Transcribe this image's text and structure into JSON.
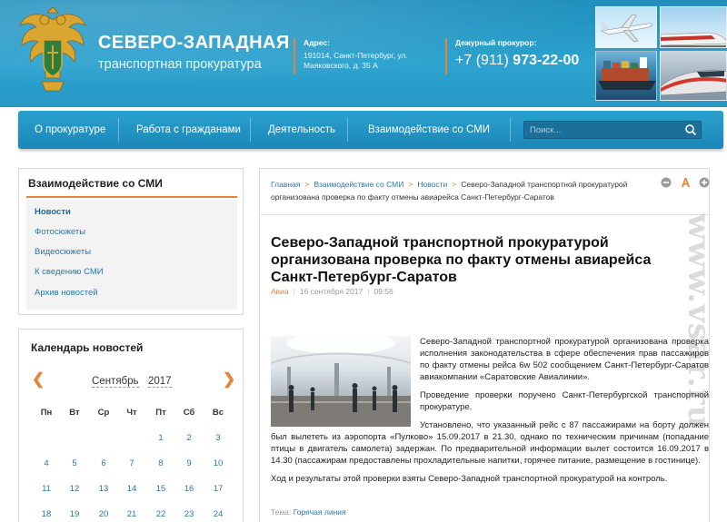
{
  "header": {
    "title": "СЕВЕРО-ЗАПАДНАЯ",
    "subtitle": "транспортная прокуратура",
    "address_label": "Адрес:",
    "address_line1": "191014, Санкт-Петербург, ул.",
    "address_line2": "Маяковского, д. 35 А",
    "duty_label": "Дежурный прокурор:",
    "phone_prefix": "+7 (911) ",
    "phone_main": "973-22-00"
  },
  "nav": {
    "items": [
      "О прокуратуре",
      "Работа с гражданами",
      "Деятельность",
      "Взаимодействие со СМИ"
    ],
    "search_placeholder": "Поиск..."
  },
  "sidebar": {
    "title": "Взаимодействие со СМИ",
    "items": [
      {
        "label": "Новости",
        "active": true
      },
      {
        "label": "Фотосюжеты"
      },
      {
        "label": "Видеосюжеты"
      },
      {
        "label": "К сведению СМИ"
      },
      {
        "label": "Архив новостей"
      }
    ]
  },
  "calendar": {
    "title": "Календарь новостей",
    "prev": "❮",
    "next": "❯",
    "month": "Сентябрь",
    "year": "2017",
    "weekdays": [
      "Пн",
      "Вт",
      "Ср",
      "Чт",
      "Пт",
      "Сб",
      "Вс"
    ],
    "weeks": [
      [
        "",
        "",
        "",
        "",
        "1",
        "2",
        "3"
      ],
      [
        "4",
        "5",
        "6",
        "7",
        "8",
        "9",
        "10"
      ],
      [
        "11",
        "12",
        "13",
        "14",
        "15",
        "16",
        "17"
      ],
      [
        "18",
        "19",
        "20",
        "21",
        "22",
        "23",
        "24"
      ]
    ]
  },
  "breadcrumbs": [
    "Главная",
    "Взаимодействие со СМИ",
    "Новости",
    "Северо-Западной транспортной прокуратурой организована проверка по факту отмены авиарейса Санкт-Петербург-Саратов"
  ],
  "breadcrumb_sep": ">",
  "article": {
    "title": "Северо-Западной транспортной прокуратурой организована проверка по факту отмены авиарейса Санкт-Петербург-Саратов",
    "rubric": "Авиа",
    "date": "16 сентября 2017",
    "time": "09:56",
    "paragraphs": [
      "Северо-Западной транспортной прокуратурой организована проверка исполнения законодательства в сфере обеспечения прав пассажиров по факту отмены рейса 6w 502 сообщением Санкт-Петербург-Саратов авиакомпании «Саратовские Авиалинии».",
      "Проведение проверки поручено Санкт-Петербургской транспортной прокуратуре.",
      "Установлено, что указанный рейс с 87 пассажирами на борту должен был вылететь из аэропорта «Пулково» 15.09.2017 в 21.30, однако по техническим причинам (попадание птицы в двигатель самолета) задержан. По предварительной информации вылет состоится 16.09.2017 в 14.30 (пассажирам предоставлены прохладительные напитки, горячее питание, размещение в гостинице).",
      "Ход и результаты этой проверки взяты Северо-Западной транспортной прокуратурой на контроль."
    ],
    "theme_label": "Тема:",
    "theme_value": "Горячая линия"
  },
  "watermark": "www.vsar.ru",
  "colors": {
    "accent": "#e8833a",
    "link": "#2778ad",
    "header": "#2598c6"
  }
}
